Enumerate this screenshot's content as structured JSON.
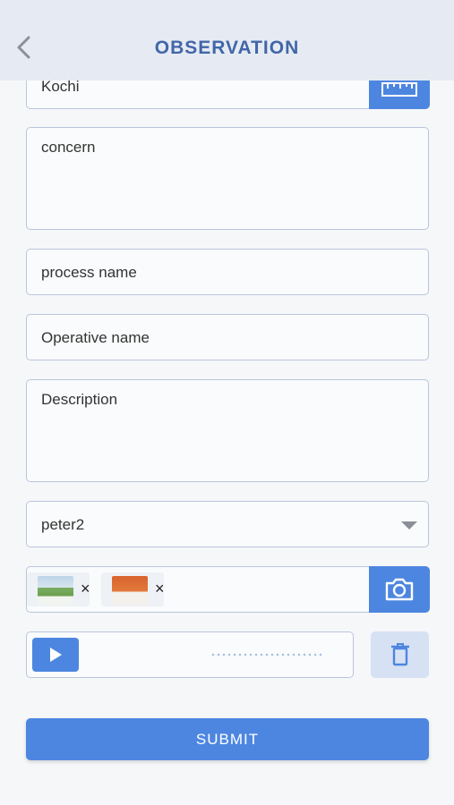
{
  "header": {
    "title": "OBSERVATION",
    "back_icon": "chevron-left-icon"
  },
  "form": {
    "location": {
      "value": "Kochi",
      "icon": "ruler-icon"
    },
    "concern": {
      "placeholder": "concern"
    },
    "process_name": {
      "placeholder": "process name"
    },
    "operative_name": {
      "placeholder": "Operative name"
    },
    "description": {
      "placeholder": "Description"
    },
    "assignee": {
      "selected": "peter2"
    },
    "attachments": {
      "items": [
        {
          "remove": "×"
        },
        {
          "remove": "×"
        }
      ],
      "camera_icon": "camera-icon"
    },
    "audio": {
      "play_icon": "play-icon",
      "delete_icon": "trash-icon"
    },
    "submit_label": "SUBMIT"
  },
  "colors": {
    "accent": "#4d86e0",
    "header_bg": "#e6ebf3",
    "title": "#4266a8"
  }
}
